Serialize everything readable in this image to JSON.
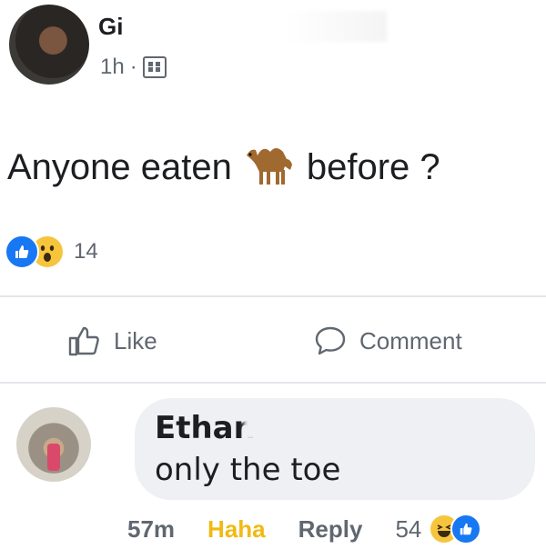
{
  "post": {
    "author": "Gi",
    "time": "1h",
    "separator": "·",
    "text_before": "Anyone eaten",
    "text_after": "before ?",
    "reaction_count": "14"
  },
  "actions": {
    "like_label": "Like",
    "comment_label": "Comment"
  },
  "comment": {
    "author": "Ethan",
    "text": "only the toe",
    "time": "57m",
    "haha_label": "Haha",
    "reply_label": "Reply",
    "reaction_count": "54"
  },
  "colors": {
    "like_blue": "#1877f2",
    "haha_yellow": "#f0ba15",
    "meta_gray": "#606770",
    "bubble_bg": "#eef0f3"
  },
  "icons": [
    "camel-emoji",
    "like-reaction",
    "wow-reaction",
    "haha-reaction",
    "privacy-icon"
  ]
}
